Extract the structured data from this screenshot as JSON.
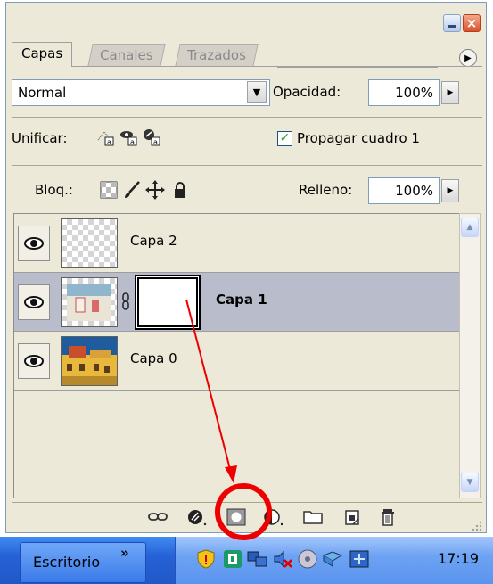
{
  "tabs": [
    {
      "label": "Capas",
      "active": true
    },
    {
      "label": "Canales",
      "active": false
    },
    {
      "label": "Trazados",
      "active": false
    }
  ],
  "blend": {
    "mode": "Normal",
    "opacity_label": "Opacidad:",
    "opacity_value": "100%"
  },
  "unify": {
    "label": "Unificar:",
    "propagate_label": "Propagar cuadro 1",
    "propagate_checked": true
  },
  "lock": {
    "label": "Bloq.:",
    "fill_label": "Relleno:",
    "fill_value": "100%"
  },
  "layers": [
    {
      "name": "Capa 2",
      "selected": false,
      "visible": true
    },
    {
      "name": "Capa 1",
      "selected": true,
      "visible": true,
      "has_mask": true
    },
    {
      "name": "Capa 0",
      "selected": false,
      "visible": true
    }
  ],
  "taskbar": {
    "desktop_label": "Escritorio",
    "chevron": "»",
    "clock": "17:19"
  },
  "colors": {
    "annotation": "#ee0000",
    "panel_bg": "#ece9d8",
    "selected_row": "#b8bccb"
  }
}
